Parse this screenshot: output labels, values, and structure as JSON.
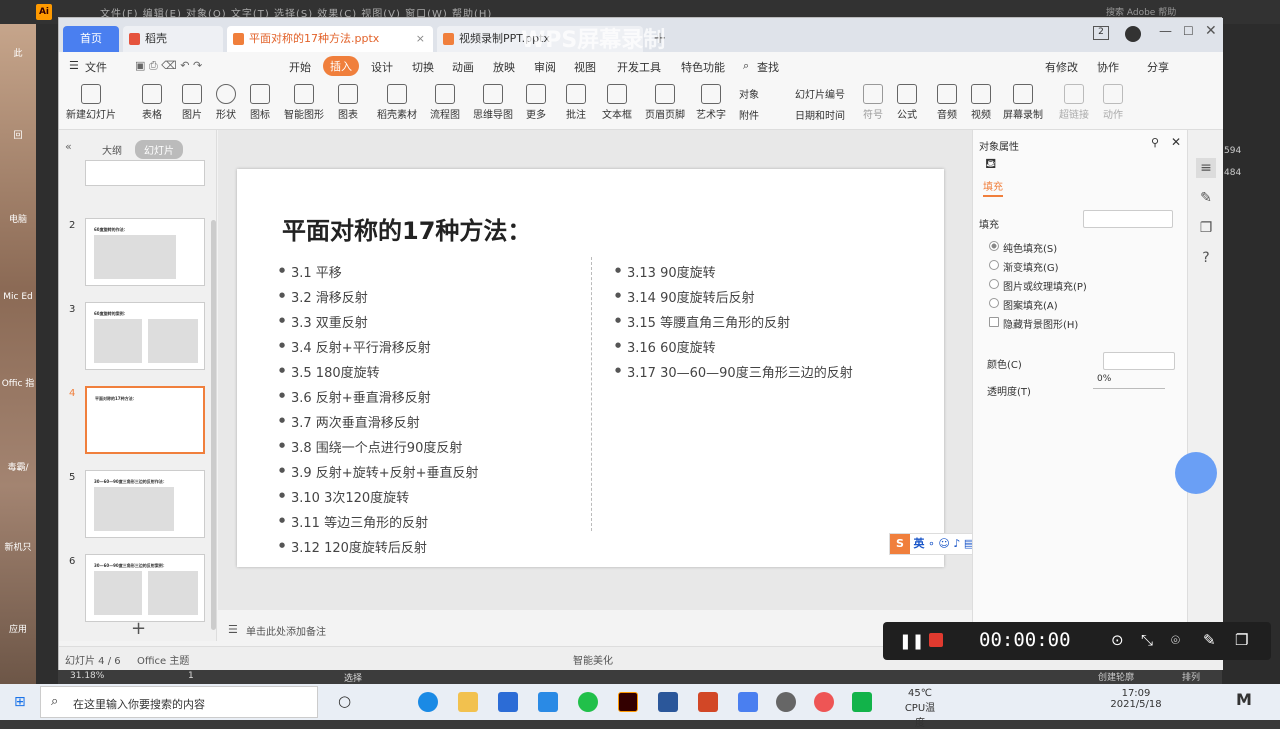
{
  "ai": {
    "logo": "Ai",
    "menu": "文件(F)  编辑(E)  对象(O)  文字(T)  选择(S)  效果(C)  视图(V)  窗口(W)  帮助(H)",
    "search": "搜索 Adobe 帮助",
    "right_nums": [
      "594",
      "484"
    ]
  },
  "desktop": {
    "labels": [
      "此",
      "回",
      "电脑",
      "Mic Ed",
      "Offic 指",
      "毒霸/",
      "新机只",
      "应用"
    ]
  },
  "watermark": "WPS屏幕录制",
  "tabs": {
    "home": "首页",
    "daoke": "稻壳",
    "doc1": "平面对称的17种方法.pptx",
    "doc2": "视频录制PPT.pptx",
    "plus": "+",
    "page_num": "2"
  },
  "menubar": {
    "file": "文件",
    "items": [
      "开始",
      "插入",
      "设计",
      "切换",
      "动画",
      "放映",
      "审阅",
      "视图",
      "开发工具",
      "特色功能"
    ],
    "active": "插入",
    "search": "查找",
    "modified": "有修改",
    "collab": "协作",
    "share": "分享"
  },
  "ribbon": {
    "groups": [
      "新建幻灯片",
      "表格",
      "图片",
      "形状",
      "图标",
      "智能图形",
      "图表",
      "稻壳素材",
      "流程图",
      "思维导图",
      "更多",
      "批注",
      "文本框",
      "页眉页脚",
      "艺术字"
    ],
    "small": [
      "对象",
      "幻灯片编号",
      "附件",
      "日期和时间"
    ],
    "groups2": [
      "符号",
      "公式",
      "音频",
      "视频",
      "屏幕录制",
      "超链接",
      "动作"
    ]
  },
  "leftpanel": {
    "tab_outline": "大纲",
    "tab_slides": "幻灯片",
    "add": "+",
    "thumbs": [
      {
        "num": "2",
        "title": "60度旋转的作法："
      },
      {
        "num": "3",
        "title": "60度旋转的案例："
      },
      {
        "num": "4",
        "title": "平面对称的17种方法："
      },
      {
        "num": "5",
        "title": "30—60—90度三角形三边的反射作法："
      },
      {
        "num": "6",
        "title": "30—60—90度三角形三边的反射案例："
      }
    ]
  },
  "slide": {
    "title": "平面对称的17种方法：",
    "left": [
      "3.1 平移",
      "3.2 滑移反射",
      "3.3 双重反射",
      "3.4 反射+平行滑移反射",
      "3.5 180度旋转",
      "3.6 反射+垂直滑移反射",
      "3.7 两次垂直滑移反射",
      "3.8 围绕一个点进行90度反射",
      "3.9 反射+旋转+反射+垂直反射",
      "3.10 3次120度旋转",
      "3.11 等边三角形的反射",
      "3.12 120度旋转后反射"
    ],
    "right": [
      "3.13 90度旋转",
      "3.14 90度旋转后反射",
      "3.15 等腰直角三角形的反射",
      "3.16 60度旋转",
      "3.17 30—60—90度三角形三边的反射"
    ]
  },
  "ime": {
    "label": "英"
  },
  "rightpanel": {
    "title": "对象属性",
    "tab_fill": "填充",
    "section": "填充",
    "options": [
      "纯色填充(S)",
      "渐变填充(G)",
      "图片或纹理填充(P)",
      "图案填充(A)"
    ],
    "hide_bg": "隐藏背景图形(H)",
    "color": "颜色(C)",
    "transparency": "透明度(T)",
    "transparency_val": "0%"
  },
  "notebar": {
    "text": "单击此处添加备注"
  },
  "status": {
    "slide": "幻灯片 4 / 6",
    "theme": "Office 主题",
    "beautify": "智能美化"
  },
  "recorder": {
    "time": "00:00:00",
    "accent": "#e03a2f"
  },
  "ai_bottom": {
    "zoom": "31.18%",
    "page": "1",
    "mode": "选择",
    "grid": "创建轮廓",
    "arrange": "排列"
  },
  "taskbar": {
    "search": "在这里输入你要搜索的内容",
    "temp": "45℃",
    "temp_label": "CPU温度",
    "time": "17:09",
    "date": "2021/5/18"
  },
  "colors": {
    "wps_blue": "#4a7ff0",
    "insert_orange": "#f07f3c",
    "slide_selected": "#f07f3c"
  }
}
